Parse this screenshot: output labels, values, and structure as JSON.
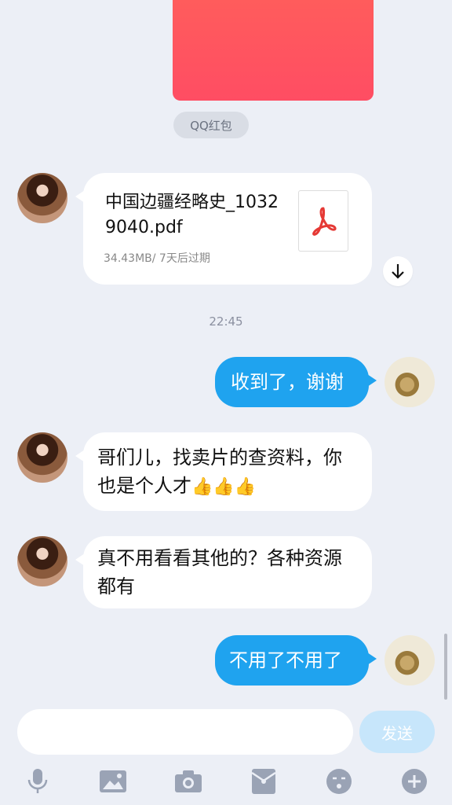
{
  "top": {
    "red_packet_label": "QQ红包"
  },
  "file_message": {
    "filename": "中国边疆经略史_10329040.pdf",
    "meta": "34.43MB/ 7天后过期"
  },
  "timestamp": "22:45",
  "messages": [
    {
      "side": "right",
      "text": "收到了，谢谢"
    },
    {
      "side": "left",
      "text": "哥们儿，找卖片的查资料，你也是个人才",
      "emoji": "👍👍👍"
    },
    {
      "side": "left",
      "text": "真不用看看其他的？各种资源都有"
    },
    {
      "side": "right",
      "text": "不用了不用了"
    }
  ],
  "input": {
    "placeholder": "",
    "send_label": "发送"
  },
  "toolbar": {
    "icons": [
      "microphone-icon",
      "image-icon",
      "camera-icon",
      "red-packet-icon",
      "emoji-icon",
      "plus-icon"
    ]
  },
  "colors": {
    "bubble_blue": "#1fa3ef",
    "background": "#eceff6",
    "send_disabled": "#c7e6fb"
  }
}
